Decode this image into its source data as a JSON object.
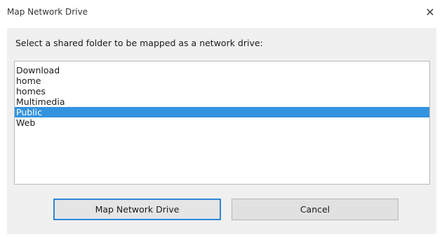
{
  "window": {
    "title": "Map Network Drive",
    "close_glyph": "✕"
  },
  "dialog": {
    "prompt": "Select a shared folder to be mapped as a network drive:",
    "folders": [
      {
        "label": "Download",
        "selected": false
      },
      {
        "label": "home",
        "selected": false
      },
      {
        "label": "homes",
        "selected": false
      },
      {
        "label": "Multimedia",
        "selected": false
      },
      {
        "label": "Public",
        "selected": true
      },
      {
        "label": "Web",
        "selected": false
      }
    ],
    "buttons": {
      "map_label": "Map Network Drive",
      "cancel_label": "Cancel"
    }
  },
  "colors": {
    "selection": "#3393df",
    "default_button_border": "#2f86d6"
  },
  "icons": {
    "close": "close-icon"
  }
}
